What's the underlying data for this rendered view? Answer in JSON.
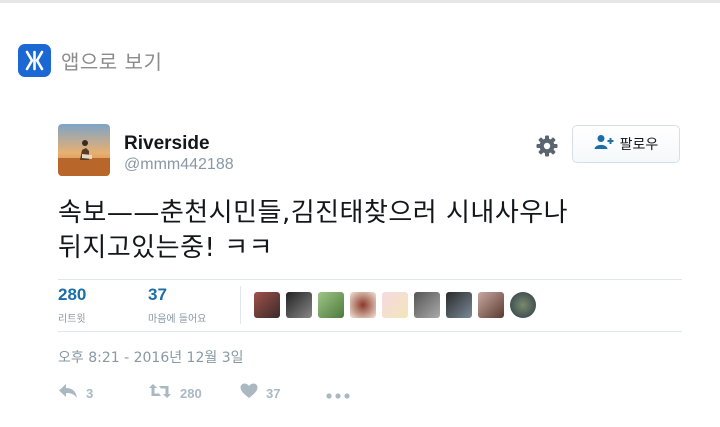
{
  "banner": {
    "app_label": "앱으로 보기",
    "icon": "app-logo-icon"
  },
  "profile": {
    "display_name": "Riverside",
    "handle": "@mmm442188",
    "avatar_icon": "avatar-image"
  },
  "follow_button": {
    "label": "팔로우",
    "icon": "add-user-icon"
  },
  "tweet": {
    "lines": [
      "속보——춘천시민들,김진태찾으러 시내사우나",
      "뒤지고있는중! ㅋㅋ"
    ]
  },
  "stats": {
    "retweets": {
      "count": "280",
      "label": "리트윗"
    },
    "likes": {
      "count": "37",
      "label": "마음에 들어요"
    }
  },
  "timestamp": "오후 8:21 - 2016년 12월 3일",
  "actions": {
    "reply_count": "3",
    "retweet_count": "280",
    "like_count": "37"
  },
  "colors": {
    "accent": "#1b6ea8",
    "muted": "#8899a6",
    "app_icon": "#1b68d4"
  }
}
